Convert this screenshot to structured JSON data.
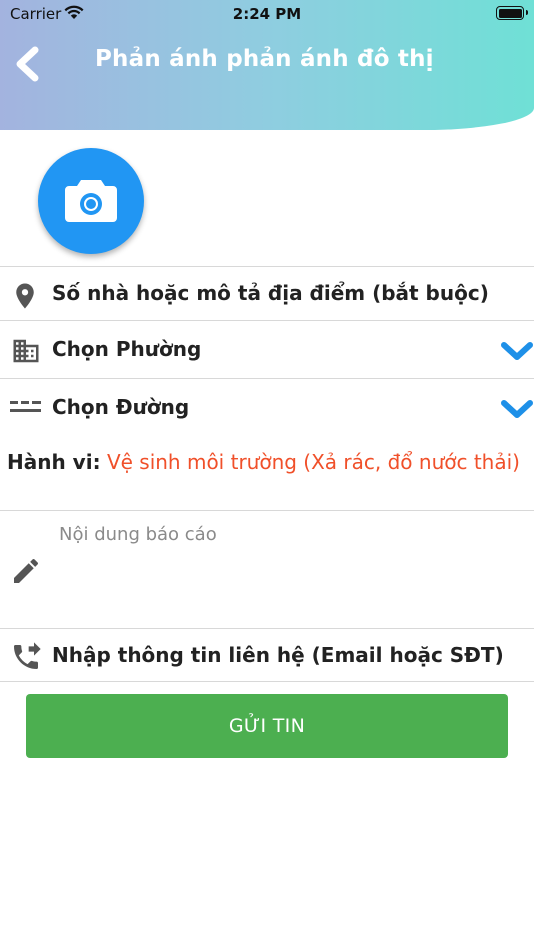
{
  "status_bar": {
    "carrier": "Carrier",
    "time": "2:24 PM"
  },
  "header": {
    "title": "Phản ánh phản ánh đô thị",
    "back_icon": "chevron-left-icon"
  },
  "camera": {
    "icon": "camera-icon",
    "color": "#2196f3"
  },
  "form": {
    "address": {
      "label": "Số nhà hoặc mô tả địa điểm (bắt buộc)",
      "icon": "location-pin-icon"
    },
    "ward": {
      "label": "Chọn Phường",
      "icon": "building-icon"
    },
    "street": {
      "label": "Chọn Đường",
      "icon": "road-icon"
    },
    "behavior": {
      "label": "Hành vi:",
      "value": "Vệ sinh môi trường (Xả rác, đổ nước thải)",
      "value_color": "#f0502a"
    },
    "content": {
      "placeholder": "Nội dung báo cáo",
      "icon": "pencil-icon"
    },
    "contact": {
      "label": "Nhập thông tin liên hệ (Email hoặc SĐT)",
      "icon": "phone-forward-icon"
    }
  },
  "submit": {
    "label": "GỬI TIN",
    "color": "#4caf50"
  },
  "colors": {
    "accent_blue": "#2196f3",
    "chevron": "#1e90e8",
    "icon_gray": "#555555"
  }
}
